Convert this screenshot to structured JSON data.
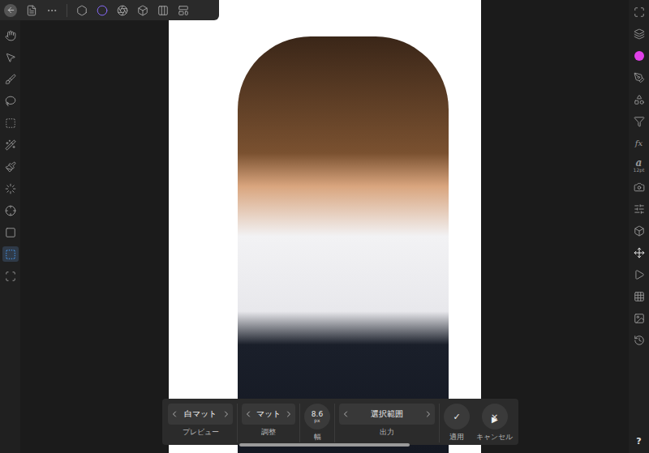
{
  "context_toolbar": {
    "controls": [
      {
        "kind": "stepper",
        "value": "白マット",
        "label": "プレビュー"
      },
      {
        "kind": "stepper",
        "value": "マット",
        "label": "調整"
      },
      {
        "kind": "dial",
        "value": "8.6",
        "unit": "px",
        "label": "幅"
      },
      {
        "kind": "stepper",
        "value": "選択範囲",
        "label": "出力"
      },
      {
        "kind": "button",
        "value": "✓",
        "label": "適用"
      },
      {
        "kind": "button",
        "value": "×",
        "label": "キャンセル"
      }
    ],
    "expand": "▶"
  },
  "tools": [
    {
      "selected": false
    },
    {
      "selected": false
    },
    {
      "selected": false
    },
    {
      "selected": false
    },
    {
      "selected": false
    },
    {
      "selected": false
    },
    {
      "selected": false
    },
    {
      "selected": false
    },
    {
      "selected": false
    },
    {
      "selected": false
    },
    {
      "selected": true
    },
    {
      "selected": false
    }
  ],
  "studio": {
    "current_color": "#e040e8",
    "fx_label": "fx",
    "text_glyph": "a",
    "text_size": "12pt",
    "help": "?",
    "selected_panel": "navigator"
  }
}
